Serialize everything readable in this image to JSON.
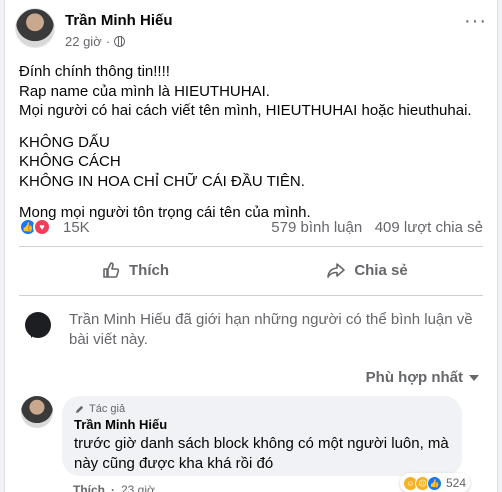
{
  "post": {
    "author": "Trần Minh Hiếu",
    "time": "22 giờ",
    "more_label": "···",
    "lines": {
      "p1": [
        "Đính chính thông tin!!!!",
        "Rap name của mình là HIEUTHUHAI.",
        "Mọi người có hai cách viết tên mình, HIEUTHUHAI hoặc hieuthuhai."
      ],
      "p2": [
        "KHÔNG DẤU",
        "KHÔNG CÁCH",
        "KHÔNG IN HOA CHỈ CHỮ CÁI ĐẦU TIÊN."
      ],
      "p3": [
        "Mong mọi người tôn trọng cái tên của mình."
      ]
    }
  },
  "reactions": {
    "count": "15K",
    "comments": "579 bình luận",
    "shares": "409 lượt chia sẻ",
    "like_color": "#1877f2",
    "love_color": "#f33e58"
  },
  "actions": {
    "like": "Thích",
    "share": "Chia sẻ"
  },
  "notice": {
    "text": "Trần Minh Hiếu đã giới hạn những người có thể bình luận về bài viết này."
  },
  "sort": {
    "label": "Phù hợp nhất"
  },
  "comment": {
    "badge": "Tác giả",
    "author": "Trần Minh Hiếu",
    "text": "trước giờ danh sách block không có một người luôn, mà này cũng được kha khá rồi đó",
    "react_count": "524",
    "like_label": "Thích",
    "time": "23 giờ"
  }
}
